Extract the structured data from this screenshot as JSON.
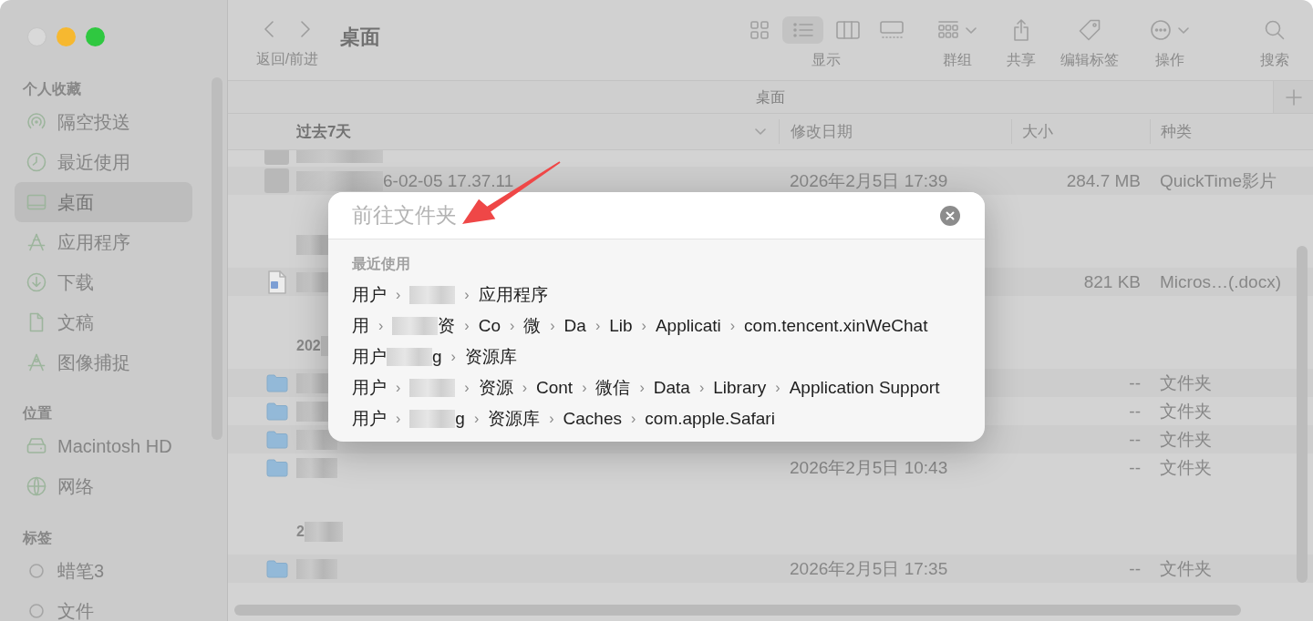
{
  "sidebar": {
    "sections": [
      {
        "title": "个人收藏",
        "items": [
          {
            "label": "隔空投送",
            "selected": false
          },
          {
            "label": "最近使用",
            "selected": false
          },
          {
            "label": "桌面",
            "selected": true
          },
          {
            "label": "应用程序",
            "selected": false
          },
          {
            "label": "下载",
            "selected": false
          },
          {
            "label": "文稿",
            "selected": false
          },
          {
            "label": "图像捕捉",
            "selected": false
          }
        ]
      },
      {
        "title": "位置",
        "items": [
          {
            "label": "Macintosh HD",
            "selected": false
          },
          {
            "label": "网络",
            "selected": false
          }
        ]
      },
      {
        "title": "标签",
        "items": [
          {
            "label": "蜡笔3",
            "selected": false
          },
          {
            "label": "文件",
            "selected": false
          }
        ]
      }
    ]
  },
  "toolbar": {
    "nav_label": "返回/前进",
    "title": "桌面",
    "view_label": "显示",
    "view_modes": [
      {
        "selected": false
      },
      {
        "selected": true
      },
      {
        "selected": false
      },
      {
        "selected": false
      }
    ],
    "tools": [
      {
        "label": "群组"
      },
      {
        "label": "共享"
      },
      {
        "label": "编辑标签"
      },
      {
        "label": "操作"
      },
      {
        "label": "搜索"
      }
    ]
  },
  "tab_bar": {
    "tabs": [
      {
        "label": "桌面"
      }
    ]
  },
  "column_header": {
    "group": "过去7天",
    "columns": [
      "修改日期",
      "大小",
      "种类"
    ]
  },
  "groups": [
    {
      "items": [
        {
          "kind": "video"
        },
        {
          "kind": "video",
          "name": "6-02-05 17.37.11",
          "date": "2026年2月5日 17:39",
          "size": "284.7 MB",
          "type": "QuickTime影片"
        }
      ]
    },
    {
      "items": [
        {
          "kind": "docx",
          "size": "821 KB",
          "type": "Micros…(.docx)"
        }
      ]
    },
    {
      "label": "202",
      "items": [
        {
          "kind": "folder",
          "size": "--",
          "type": "文件夹"
        },
        {
          "kind": "folder",
          "size": "--",
          "type": "文件夹"
        },
        {
          "kind": "folder",
          "size": "--",
          "type": "文件夹"
        },
        {
          "kind": "folder",
          "date": "2026年2月5日 10:43",
          "size": "--",
          "type": "文件夹"
        }
      ]
    },
    {
      "label": "2",
      "items": [
        {
          "kind": "folder",
          "date": "2026年2月5日 17:35",
          "size": "--",
          "type": "文件夹"
        }
      ]
    }
  ],
  "go_to_folder": {
    "placeholder": "前往文件夹",
    "section": "最近使用",
    "recents": [
      {
        "parts": [
          {
            "kind": "text",
            "text": "用户"
          },
          {
            "kind": "sep",
            "text": "›"
          },
          {
            "kind": "blur"
          },
          {
            "kind": "sep",
            "text": "›"
          },
          {
            "kind": "text",
            "text": "应用程序"
          }
        ]
      },
      {
        "parts": [
          {
            "kind": "text",
            "text": "用"
          },
          {
            "kind": "sep",
            "text": "›"
          },
          {
            "kind": "blur"
          },
          {
            "kind": "text",
            "text": "资"
          },
          {
            "kind": "sep",
            "text": "›"
          },
          {
            "kind": "text",
            "text": "Co"
          },
          {
            "kind": "sep",
            "text": "›"
          },
          {
            "kind": "text",
            "text": "微"
          },
          {
            "kind": "sep",
            "text": "›"
          },
          {
            "kind": "text",
            "text": "Da"
          },
          {
            "kind": "sep",
            "text": "›"
          },
          {
            "kind": "text",
            "text": "Lib"
          },
          {
            "kind": "sep",
            "text": "›"
          },
          {
            "kind": "text",
            "text": "Applicati"
          },
          {
            "kind": "sep",
            "text": "›"
          },
          {
            "kind": "text",
            "text": "com.tencent.xinWeChat"
          }
        ]
      },
      {
        "parts": [
          {
            "kind": "text",
            "text": "用户"
          },
          {
            "kind": "blur"
          },
          {
            "kind": "text",
            "text": "g"
          },
          {
            "kind": "sep",
            "text": "›"
          },
          {
            "kind": "text",
            "text": "资源库"
          }
        ]
      },
      {
        "parts": [
          {
            "kind": "text",
            "text": "用户"
          },
          {
            "kind": "sep",
            "text": "›"
          },
          {
            "kind": "blur"
          },
          {
            "kind": "sep",
            "text": "›"
          },
          {
            "kind": "text",
            "text": "资源"
          },
          {
            "kind": "sep",
            "text": "›"
          },
          {
            "kind": "text",
            "text": "Cont"
          },
          {
            "kind": "sep",
            "text": "›"
          },
          {
            "kind": "text",
            "text": "微信"
          },
          {
            "kind": "sep",
            "text": "›"
          },
          {
            "kind": "text",
            "text": "Data"
          },
          {
            "kind": "sep",
            "text": "›"
          },
          {
            "kind": "text",
            "text": "Library"
          },
          {
            "kind": "sep",
            "text": "›"
          },
          {
            "kind": "text",
            "text": "Application Support"
          }
        ]
      },
      {
        "parts": [
          {
            "kind": "text",
            "text": "用户"
          },
          {
            "kind": "sep",
            "text": "›"
          },
          {
            "kind": "blur"
          },
          {
            "kind": "text",
            "text": "g"
          },
          {
            "kind": "sep",
            "text": "›"
          },
          {
            "kind": "text",
            "text": "资源库"
          },
          {
            "kind": "sep",
            "text": "›"
          },
          {
            "kind": "text",
            "text": "Caches"
          },
          {
            "kind": "sep",
            "text": "›"
          },
          {
            "kind": "text",
            "text": "com.apple.Safari"
          }
        ]
      }
    ]
  },
  "annotations": [
    {
      "kind": "arrow"
    }
  ]
}
